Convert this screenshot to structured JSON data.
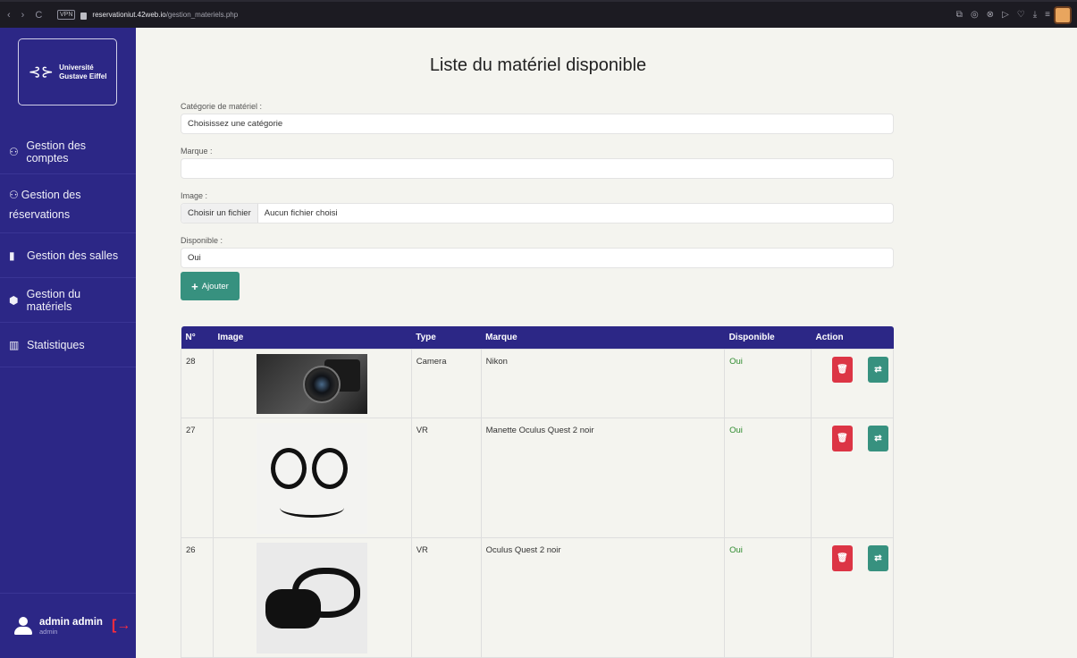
{
  "browser": {
    "nav": [
      "‹",
      "›",
      "C"
    ],
    "vpn": "VPN",
    "url_host": "reservationiut.42web.io",
    "url_path": "/gestion_materiels.php",
    "icons": [
      "⧉",
      "◎",
      "⊗",
      "▷",
      "♡",
      "⤓",
      "≡"
    ]
  },
  "sidebar": {
    "logo": {
      "line1": "Université",
      "line2": "Gustave Eiffel"
    },
    "items": [
      {
        "icon": "users-gear-icon",
        "glyph": "⚇",
        "label": "Gestion des comptes"
      },
      {
        "icon": "users-gear-icon",
        "glyph": "⚇",
        "label_line1": "Gestion des",
        "label_line2": "réservations"
      },
      {
        "icon": "door-icon",
        "glyph": "▮",
        "label": "Gestion des salles"
      },
      {
        "icon": "box-icon",
        "glyph": "⬢",
        "label": "Gestion du matériels"
      },
      {
        "icon": "chart-icon",
        "glyph": "▥",
        "label": "Statistiques"
      }
    ],
    "user": {
      "name": "admin admin",
      "role": "admin",
      "logout_glyph": "[→"
    }
  },
  "main": {
    "title": "Liste du matériel disponible",
    "form": {
      "category_label": "Catégorie de matériel :",
      "category_value": "Choisissez une catégorie",
      "brand_label": "Marque :",
      "brand_value": "",
      "image_label": "Image :",
      "file_button": "Choisir un fichier",
      "file_status": "Aucun fichier choisi",
      "available_label": "Disponible :",
      "available_value": "Oui",
      "add_button": "Ajouter"
    },
    "table": {
      "headers": [
        "N°",
        "Image",
        "Type",
        "Marque",
        "Disponible",
        "Action"
      ],
      "rows": [
        {
          "id": "28",
          "type": "Camera",
          "brand": "Nikon",
          "available": "Oui"
        },
        {
          "id": "27",
          "type": "VR",
          "brand": "Manette Oculus Quest 2 noir",
          "available": "Oui"
        },
        {
          "id": "26",
          "type": "VR",
          "brand": "Oculus Quest 2 noir",
          "available": "Oui"
        }
      ]
    }
  },
  "colors": {
    "sidebar": "#2c2786",
    "accent": "#37917f",
    "danger": "#dc3545",
    "success_text": "#2e8b2e"
  }
}
